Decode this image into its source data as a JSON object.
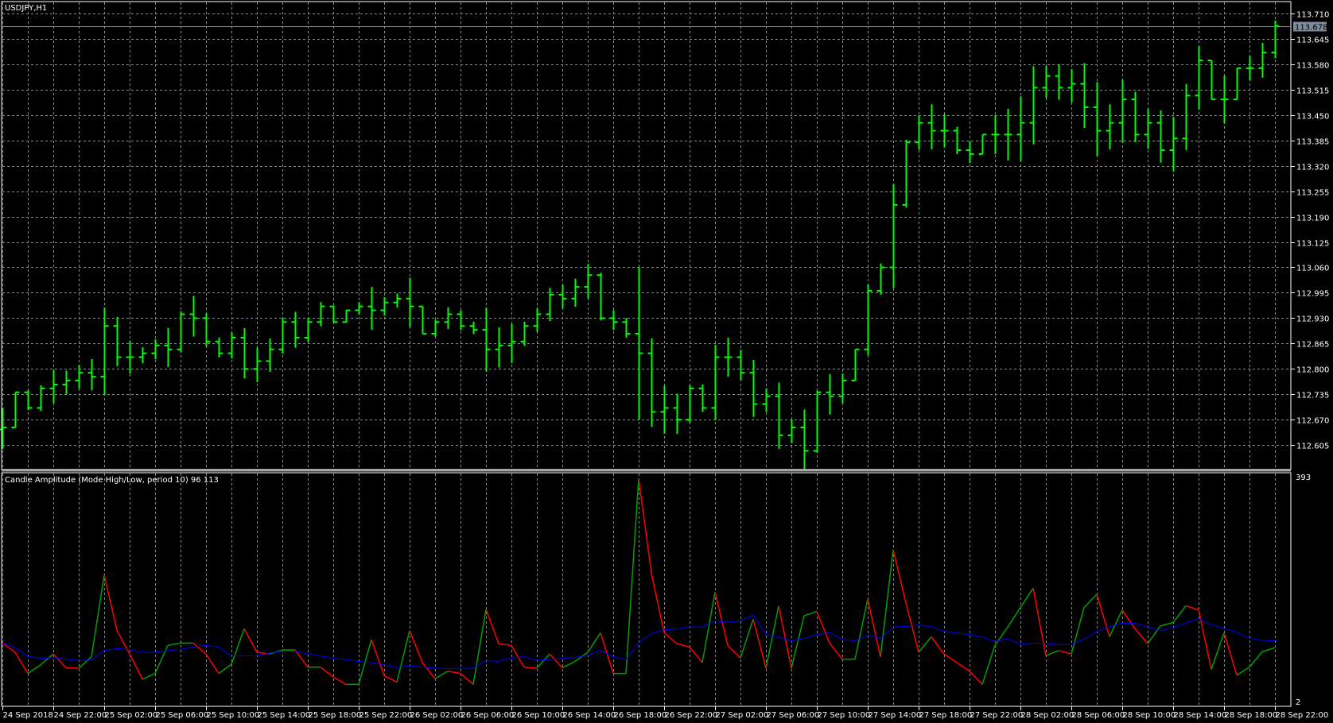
{
  "window": {
    "symbol_title": "USDJPY,H1"
  },
  "indicator": {
    "label": "Candle Amplitude (Mode High/Low, period 10) 96 113",
    "period": 10,
    "axis_max_label": "393",
    "axis_min_label": "2",
    "min": 2,
    "max": 393
  },
  "price_axis": {
    "labels": [
      "113.710",
      "113.645",
      "113.580",
      "113.515",
      "113.450",
      "113.385",
      "113.320",
      "113.255",
      "113.190",
      "113.125",
      "113.060",
      "112.995",
      "112.930",
      "112.865",
      "112.800",
      "112.735",
      "112.670",
      "112.605"
    ],
    "current_price": "113.678"
  },
  "time_axis": {
    "labels": [
      "24 Sep 2018",
      "24 Sep 22:00",
      "25 Sep 02:00",
      "25 Sep 06:00",
      "25 Sep 10:00",
      "25 Sep 14:00",
      "25 Sep 18:00",
      "25 Sep 22:00",
      "26 Sep 02:00",
      "26 Sep 06:00",
      "26 Sep 10:00",
      "26 Sep 14:00",
      "26 Sep 18:00",
      "26 Sep 22:00",
      "27 Sep 02:00",
      "27 Sep 06:00",
      "27 Sep 10:00",
      "27 Sep 14:00",
      "27 Sep 18:00",
      "27 Sep 22:00",
      "28 Sep 02:00",
      "28 Sep 06:00",
      "28 Sep 10:00",
      "28 Sep 14:00",
      "28 Sep 18:00",
      "28 Sep 22:00"
    ]
  },
  "colors": {
    "bars": "#00ff00",
    "amp_up": "#00a000",
    "amp_down": "#ff0000",
    "ma": "#0000ff",
    "grid": "#7f8c9c",
    "current_box": "#7f8c9c"
  },
  "chart_data": {
    "type": "ohlc",
    "first_open": 112.645,
    "closes": [
      112.65,
      112.74,
      112.7,
      112.75,
      112.76,
      112.77,
      112.79,
      112.78,
      112.91,
      112.83,
      112.83,
      112.84,
      112.86,
      112.85,
      112.94,
      112.93,
      112.87,
      112.84,
      112.88,
      112.8,
      112.82,
      112.85,
      112.92,
      112.88,
      112.92,
      112.96,
      112.92,
      112.95,
      112.96,
      112.95,
      112.97,
      112.98,
      112.96,
      112.89,
      112.92,
      112.94,
      112.91,
      112.9,
      112.85,
      112.86,
      112.87,
      112.91,
      112.94,
      112.99,
      112.98,
      113.01,
      113.04,
      112.93,
      112.92,
      112.89,
      112.84,
      112.69,
      112.7,
      112.67,
      112.75,
      112.7,
      112.83,
      112.83,
      112.79,
      112.71,
      112.73,
      112.63,
      112.65,
      112.59,
      112.74,
      112.73,
      112.77,
      112.85,
      113.0,
      113.06,
      113.22,
      113.38,
      113.43,
      113.41,
      113.41,
      113.36,
      113.35,
      113.4,
      113.4,
      113.4,
      113.43,
      113.52,
      113.55,
      113.52,
      113.53,
      113.47,
      113.41,
      113.43,
      113.49,
      113.4,
      113.43,
      113.36,
      113.39,
      113.5,
      113.59,
      113.49,
      113.49,
      113.57,
      113.57,
      113.61,
      113.678
    ],
    "amplitude": [
      104,
      88,
      51,
      66,
      85,
      61,
      60,
      80,
      223,
      126,
      85,
      41,
      51,
      100,
      104,
      104,
      85,
      51,
      67,
      129,
      88,
      85,
      92,
      92,
      62,
      62,
      45,
      32,
      32,
      110,
      47,
      36,
      126,
      70,
      42,
      55,
      51,
      32,
      163,
      103,
      100,
      62,
      60,
      85,
      61,
      72,
      88,
      122,
      51,
      51,
      391,
      226,
      122,
      103,
      97,
      70,
      193,
      100,
      78,
      146,
      60,
      169,
      60,
      152,
      159,
      104,
      76,
      76,
      181,
      80,
      267,
      174,
      88,
      115,
      85,
      70,
      55,
      32,
      100,
      132,
      166,
      200,
      82,
      91,
      85,
      166,
      189,
      115,
      162,
      129,
      103,
      134,
      140,
      169,
      162,
      58,
      122,
      48,
      62,
      89,
      96
    ],
    "price_range": [
      112.545,
      113.72
    ]
  }
}
